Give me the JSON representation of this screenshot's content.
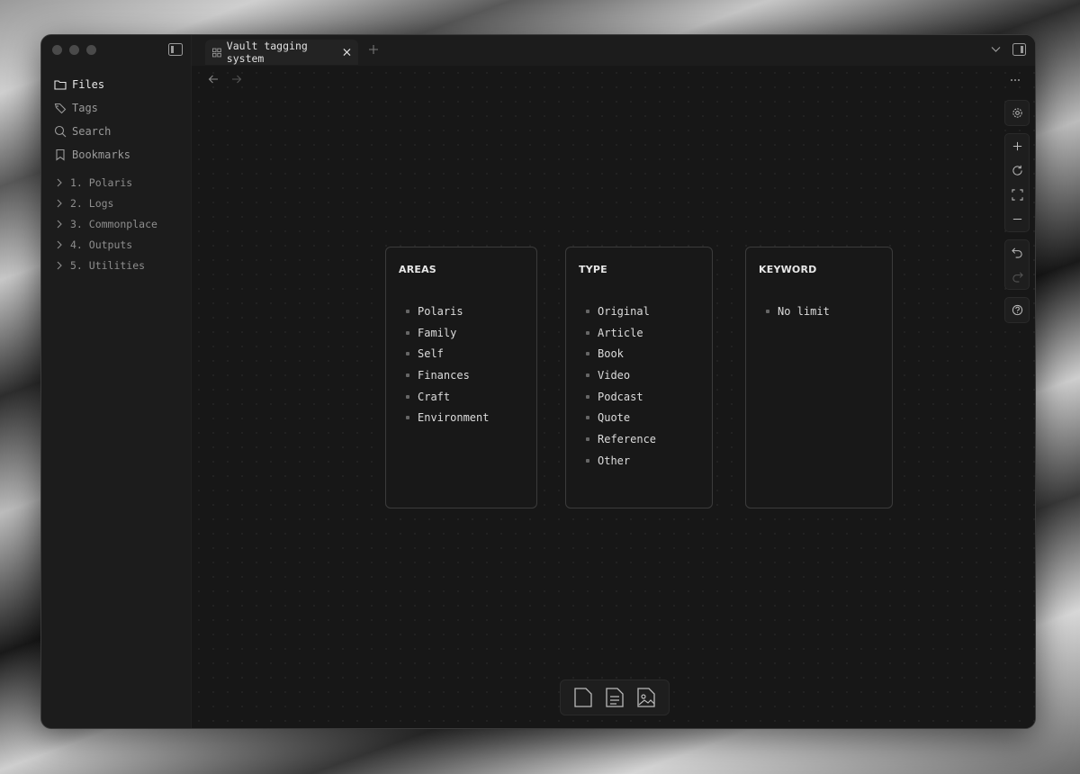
{
  "window": {
    "tab_title": "Vault tagging system"
  },
  "sidebar": {
    "nav": [
      {
        "label": "Files",
        "icon": "folder-icon",
        "active": true
      },
      {
        "label": "Tags",
        "icon": "tag-icon"
      },
      {
        "label": "Search",
        "icon": "search-icon"
      },
      {
        "label": "Bookmarks",
        "icon": "bookmark-icon"
      }
    ],
    "folders": [
      {
        "label": "1. Polaris"
      },
      {
        "label": "2. Logs"
      },
      {
        "label": "3. Commonplace"
      },
      {
        "label": "4. Outputs"
      },
      {
        "label": "5. Utilities"
      }
    ]
  },
  "canvas": {
    "cards": [
      {
        "title": "AREAS",
        "items": [
          "Polaris",
          "Family",
          "Self",
          "Finances",
          "Craft",
          "Environment"
        ]
      },
      {
        "title": "TYPE",
        "items": [
          "Original",
          "Article",
          "Book",
          "Video",
          "Podcast",
          "Quote",
          "Reference",
          "Other"
        ]
      },
      {
        "title": "KEYWORD",
        "items": [
          "No limit"
        ]
      }
    ]
  },
  "colors": {
    "background": "#171717",
    "sidebar": "#1c1c1c",
    "card_border": "#3b3b3b",
    "text": "#dcdcdc"
  }
}
